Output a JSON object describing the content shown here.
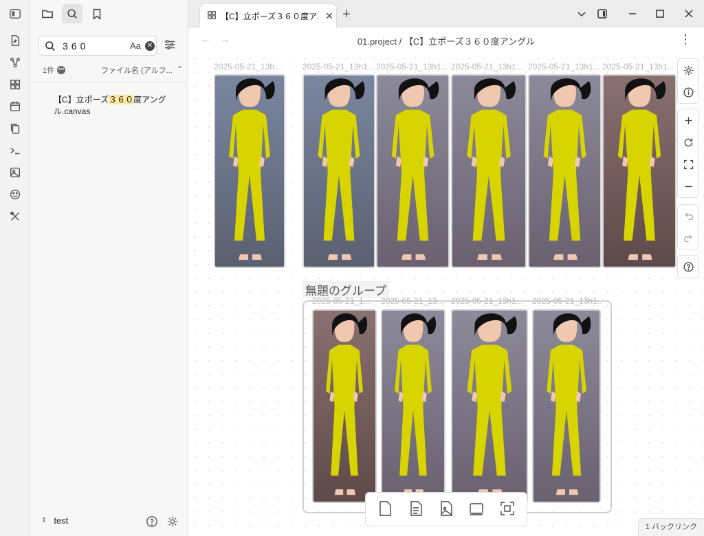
{
  "ribbon": {
    "icons": [
      "sidebar-toggle-icon",
      "new-note-icon",
      "graph-icon",
      "dashboard-icon",
      "calendar-icon",
      "copy-icon",
      "terminal-icon",
      "image-icon",
      "emoji-icon",
      "tools-icon"
    ]
  },
  "sidebar": {
    "tabs": [
      "folder-icon",
      "search-icon",
      "bookmark-icon"
    ],
    "search": {
      "value": "360",
      "case_toggle": "Aa"
    },
    "result_count": "1件",
    "sort": "ファイル名 (アルフ...",
    "result": {
      "pre": "【C】立ポーズ",
      "match": "３６０",
      "post": "度アングル.canvas"
    },
    "vault_name": "test"
  },
  "tab": {
    "title": "【C】立ポーズ３６０度ア..."
  },
  "breadcrumb": {
    "folder": "01.project",
    "sep": "/",
    "file": "【C】立ポーズ３６０度アングル"
  },
  "canvas": {
    "row1_labels": [
      "2025-05-21_13h...",
      "2025-05-21_13h1...",
      "2025-05-21_13h1...",
      "2025-05-21_13h1...",
      "2025-05-21_13h1...",
      "2025-05-21_13h1..."
    ],
    "group_name": "無題のグループ",
    "row2_labels": [
      "2025-05-21_1...",
      "2025-05-21_13...",
      "2025-05-21_13h1...",
      "2025-05-21_13h1..."
    ]
  },
  "status": {
    "backlinks": "1 バックリンク"
  }
}
